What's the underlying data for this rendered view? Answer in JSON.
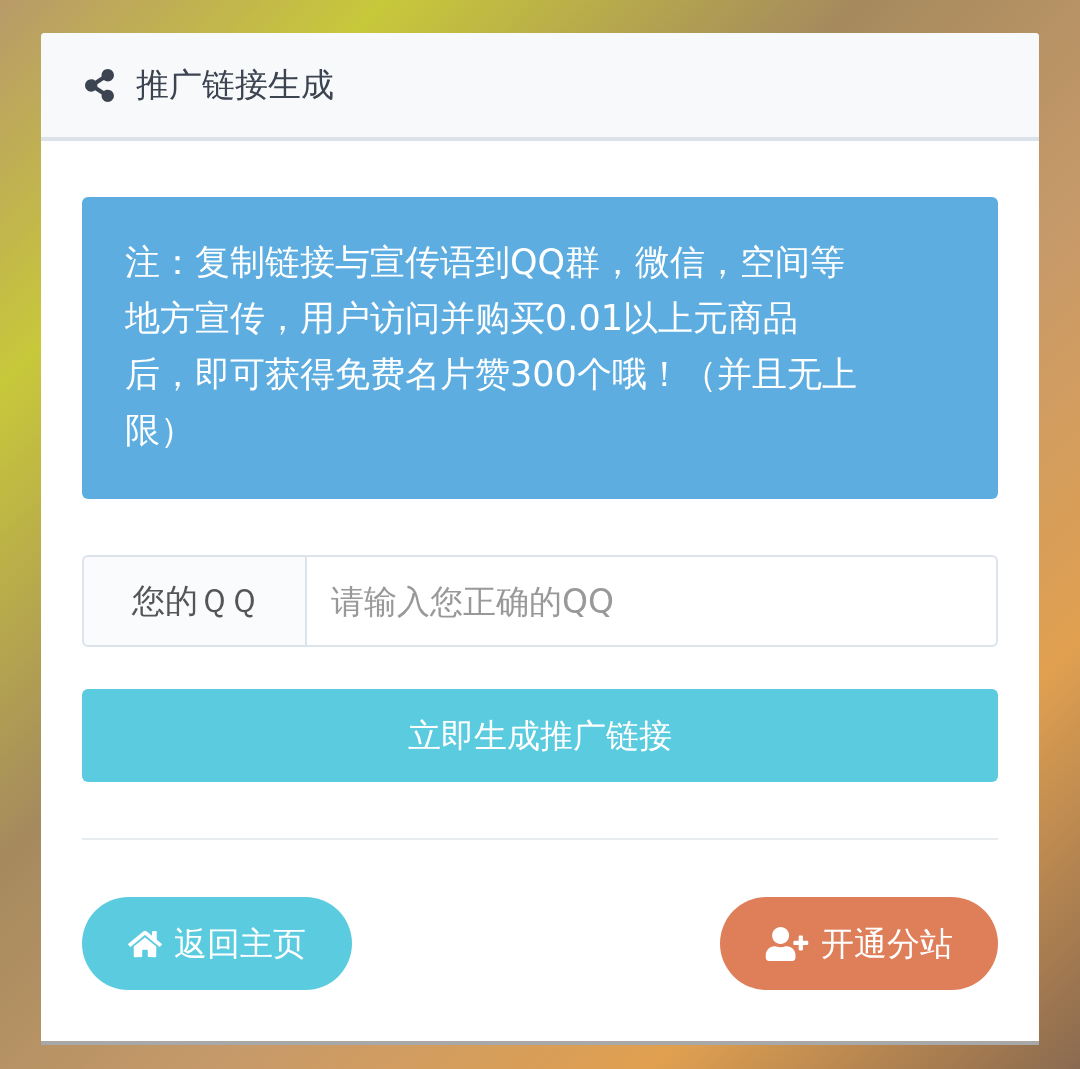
{
  "header": {
    "title": "推广链接生成"
  },
  "notice": {
    "text": "注：复制链接与宣传语到QQ群，微信，空间等地方宣传，用户访问并购买0.01以上元商品后，即可获得免费名片赞300个哦！（并且无上限）"
  },
  "qq_field": {
    "label": "您的ＱＱ",
    "placeholder": "请输入您正确的QQ"
  },
  "generate_button": {
    "label": "立即生成推广链接"
  },
  "footer_buttons": [
    {
      "label": "返回主页",
      "kind": "home"
    },
    {
      "label": "开通分站",
      "kind": "substation"
    }
  ]
}
